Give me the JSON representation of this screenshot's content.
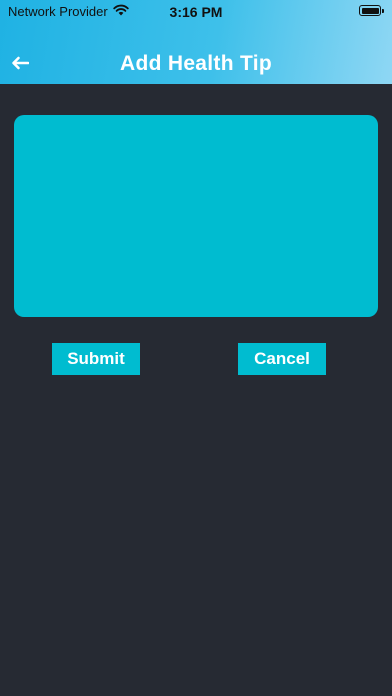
{
  "status_bar": {
    "carrier": "Network Provider",
    "time": "3:16 PM"
  },
  "header": {
    "title": "Add Health Tip",
    "back_icon": "arrow-left-icon"
  },
  "form": {
    "tip_value": "",
    "submit_label": "Submit",
    "cancel_label": "Cancel"
  },
  "colors": {
    "header_gradient_start": "#1fb2e3",
    "header_gradient_end": "#8fd7f4",
    "background": "#262a33",
    "accent": "#00bcd0",
    "text": "#ffffff"
  }
}
